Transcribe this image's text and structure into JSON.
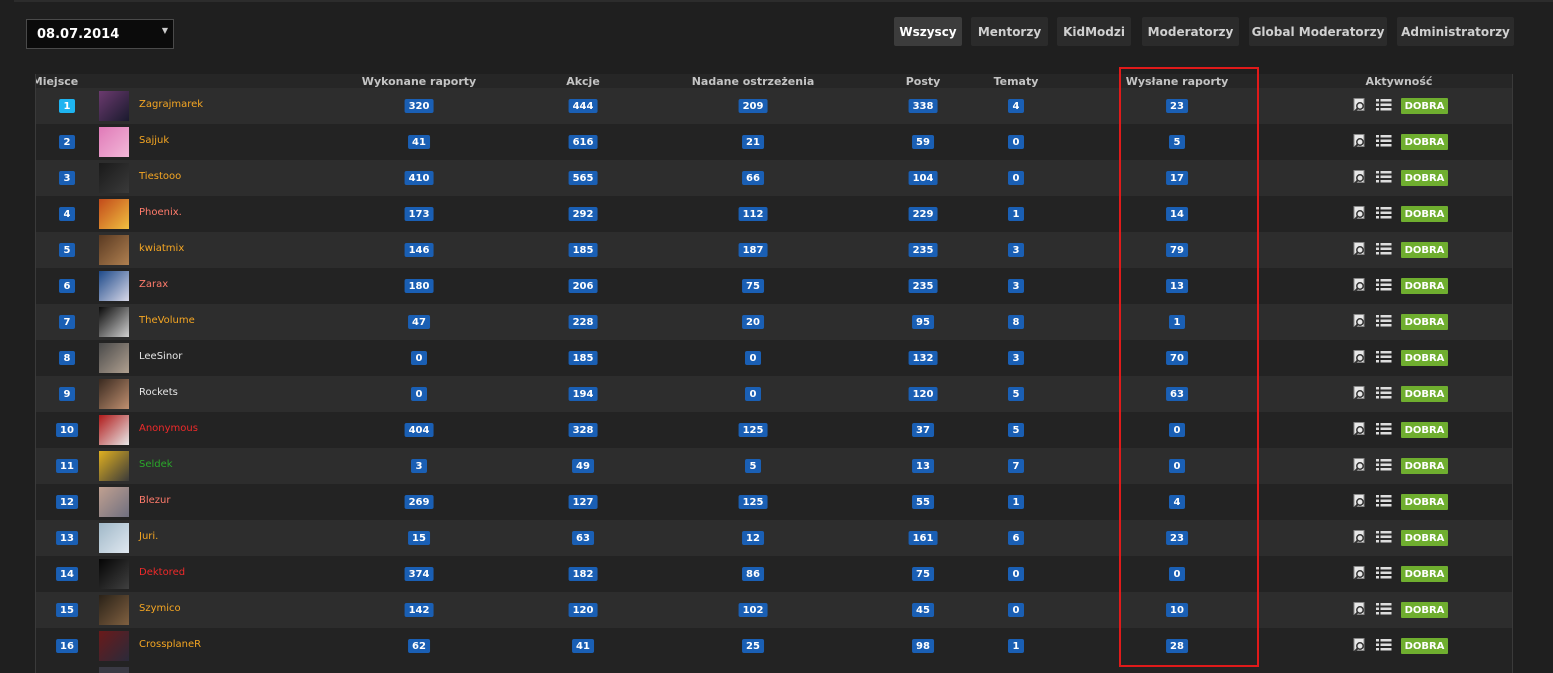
{
  "date_selector": {
    "value": "08.07.2014"
  },
  "filters": [
    "Wszyscy",
    "Mentorzy",
    "KidModzi",
    "Moderatorzy",
    "Global Moderatorzy",
    "Administratorzy"
  ],
  "active_filter": "Wszyscy",
  "columns": {
    "rank": "Miejsce",
    "done_reports": "Wykonane raporty",
    "actions": "Akcje",
    "warnings": "Nadane ostrzeżenia",
    "posts": "Posty",
    "topics": "Tematy",
    "sent_reports": "Wysłane raporty",
    "activity": "Aktywność"
  },
  "activity_label": "DOBRA",
  "colors": {
    "orange": "#f5a623",
    "salmon": "#ff7b6b",
    "white": "#e6e6e6",
    "red": "#ee2a2a",
    "green": "#2aa82a",
    "badge": "#1a5fb4",
    "highlight": "#e01a1a"
  },
  "rows": [
    {
      "rank": "1",
      "name": "Zagrajmarek",
      "color": "orange",
      "done": "320",
      "actions": "444",
      "warnings": "209",
      "posts": "338",
      "topics": "4",
      "sent": "23",
      "avatar": [
        "#6b3a6e",
        "#1a1a2e"
      ]
    },
    {
      "rank": "2",
      "name": "Sajjuk",
      "color": "orange",
      "done": "41",
      "actions": "616",
      "warnings": "21",
      "posts": "59",
      "topics": "0",
      "sent": "5",
      "avatar": [
        "#e07ab8",
        "#f2b8d8"
      ]
    },
    {
      "rank": "3",
      "name": "Tiestooo",
      "color": "orange",
      "done": "410",
      "actions": "565",
      "warnings": "66",
      "posts": "104",
      "topics": "0",
      "sent": "17",
      "avatar": [
        "#1a1a1a",
        "#3a3a3a"
      ]
    },
    {
      "rank": "4",
      "name": "Phoenix.",
      "color": "salmon",
      "done": "173",
      "actions": "292",
      "warnings": "112",
      "posts": "229",
      "topics": "1",
      "sent": "14",
      "avatar": [
        "#c24a1a",
        "#f0c040"
      ]
    },
    {
      "rank": "5",
      "name": "kwiatmix",
      "color": "orange",
      "done": "146",
      "actions": "185",
      "warnings": "187",
      "posts": "235",
      "topics": "3",
      "sent": "79",
      "avatar": [
        "#5a3a22",
        "#b08050"
      ]
    },
    {
      "rank": "6",
      "name": "Zarax",
      "color": "salmon",
      "done": "180",
      "actions": "206",
      "warnings": "75",
      "posts": "235",
      "topics": "3",
      "sent": "13",
      "avatar": [
        "#1e4a8a",
        "#d8d8e8"
      ]
    },
    {
      "rank": "7",
      "name": "TheVolume",
      "color": "orange",
      "done": "47",
      "actions": "228",
      "warnings": "20",
      "posts": "95",
      "topics": "8",
      "sent": "1",
      "avatar": [
        "#0a0a0a",
        "#d0d0d0"
      ]
    },
    {
      "rank": "8",
      "name": "LeeSinor",
      "color": "white",
      "done": "0",
      "actions": "185",
      "warnings": "0",
      "posts": "132",
      "topics": "3",
      "sent": "70",
      "avatar": [
        "#4a4a4a",
        "#b0a090"
      ]
    },
    {
      "rank": "9",
      "name": "Rockets",
      "color": "white",
      "done": "0",
      "actions": "194",
      "warnings": "0",
      "posts": "120",
      "topics": "5",
      "sent": "63",
      "avatar": [
        "#3a2a20",
        "#c09070"
      ]
    },
    {
      "rank": "10",
      "name": "Anonymous",
      "color": "red",
      "done": "404",
      "actions": "328",
      "warnings": "125",
      "posts": "37",
      "topics": "5",
      "sent": "0",
      "avatar": [
        "#b01a1a",
        "#e8e8e8"
      ]
    },
    {
      "rank": "11",
      "name": "Seldek",
      "color": "green",
      "done": "3",
      "actions": "49",
      "warnings": "5",
      "posts": "13",
      "topics": "7",
      "sent": "0",
      "avatar": [
        "#e0b020",
        "#3a3a3a"
      ]
    },
    {
      "rank": "12",
      "name": "Blezur",
      "color": "salmon",
      "done": "269",
      "actions": "127",
      "warnings": "125",
      "posts": "55",
      "topics": "1",
      "sent": "4",
      "avatar": [
        "#c0a090",
        "#707080"
      ]
    },
    {
      "rank": "13",
      "name": "Juri.",
      "color": "orange",
      "done": "15",
      "actions": "63",
      "warnings": "12",
      "posts": "161",
      "topics": "6",
      "sent": "23",
      "avatar": [
        "#a0b8c8",
        "#e0e8f0"
      ]
    },
    {
      "rank": "14",
      "name": "Dektored",
      "color": "red",
      "done": "374",
      "actions": "182",
      "warnings": "86",
      "posts": "75",
      "topics": "0",
      "sent": "0",
      "avatar": [
        "#050505",
        "#404040"
      ]
    },
    {
      "rank": "15",
      "name": "Szymico",
      "color": "orange",
      "done": "142",
      "actions": "120",
      "warnings": "102",
      "posts": "45",
      "topics": "0",
      "sent": "10",
      "avatar": [
        "#2a2218",
        "#806040"
      ]
    },
    {
      "rank": "16",
      "name": "CrossplaneR",
      "color": "orange",
      "done": "62",
      "actions": "41",
      "warnings": "25",
      "posts": "98",
      "topics": "1",
      "sent": "28",
      "avatar": [
        "#6a1a1a",
        "#2a2a3a"
      ]
    }
  ]
}
